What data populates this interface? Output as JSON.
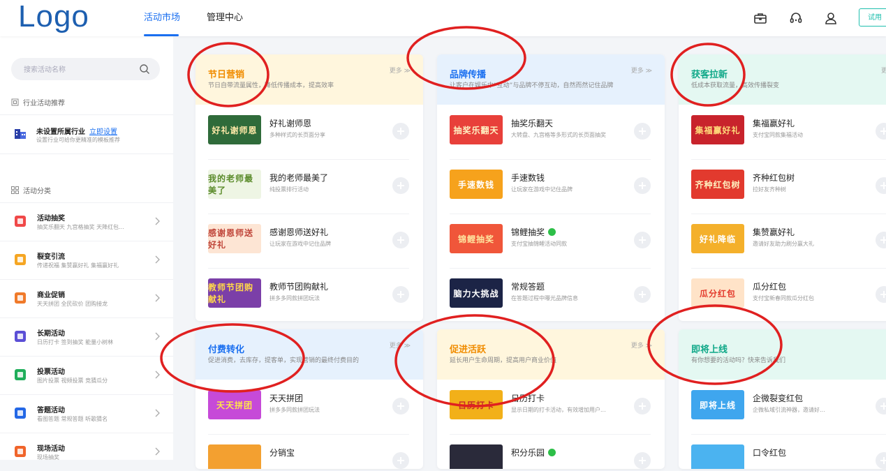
{
  "header": {
    "logo": "Logo",
    "tabs": [
      "活动市场",
      "管理中心"
    ],
    "active_tab": 0,
    "icons": [
      "briefcase-icon",
      "headset-icon",
      "user-icon"
    ],
    "trial_label": "试用"
  },
  "sidebar": {
    "search_placeholder": "搜索活动名称",
    "industry_section": "行业活动推荐",
    "industry": {
      "title": "未设置所属行业",
      "link": "立即设置",
      "subtitle": "设置行业可给你更精准的模板推荐"
    },
    "category_section": "活动分类",
    "categories": [
      {
        "title": "活动抽奖",
        "subtitle": "抽奖乐翻天  九宫格抽奖  天降红包...",
        "color": "#f04848"
      },
      {
        "title": "裂变引流",
        "subtitle": "传递祝福  集赞赢好礼  集福赢好礼",
        "color": "#f5a623"
      },
      {
        "title": "商业促销",
        "subtitle": "天天拼团  全民砍价  团购接龙",
        "color": "#f07a2a"
      },
      {
        "title": "长期活动",
        "subtitle": "日历打卡  签到抽奖  能量小树林",
        "color": "#5b4fd6"
      },
      {
        "title": "投票活动",
        "subtitle": "图片投票  视频投票  竞猜瓜分",
        "color": "#1fae5a"
      },
      {
        "title": "答题活动",
        "subtitle": "看图答题  常规答题  听歌猜名",
        "color": "#2468e6"
      },
      {
        "title": "现场活动",
        "subtitle": "现场抽奖",
        "color": "#f0642a"
      }
    ]
  },
  "cards": [
    {
      "title": "节日营销",
      "title_color": "#f08c00",
      "head_bg": "#fff6dd",
      "desc": "节日自带流量属性，降低传播成本，提高效率",
      "more": "更多 ≫",
      "items": [
        {
          "title": "好礼谢师恩",
          "subtitle": "多种样式的长页面分享",
          "thumb_text": "好礼谢师恩",
          "thumb_bg": "#2f6b3a",
          "thumb_fg": "#ffe9a8"
        },
        {
          "title": "我的老师最美了",
          "subtitle": "纯投票排行活动",
          "thumb_text": "我的老师最美了",
          "thumb_bg": "#eef5e4",
          "thumb_fg": "#5a8b2a"
        },
        {
          "title": "感谢恩师送好礼",
          "subtitle": "让玩家在游戏中记住品牌",
          "thumb_text": "感谢恩师送好礼",
          "thumb_bg": "#fde5d4",
          "thumb_fg": "#c0463a"
        },
        {
          "title": "教师节团购献礼",
          "subtitle": "拼多多同款拼团玩法",
          "thumb_text": "教师节团购献礼",
          "thumb_bg": "#7b3fa8",
          "thumb_fg": "#ffd84a"
        }
      ]
    },
    {
      "title": "品牌传播",
      "title_color": "#1a6ff0",
      "head_bg": "#e6f1fd",
      "desc": "让客户在娱乐中“互动”与品牌不停互动，自然而然记住品牌",
      "more": "更多 ≫",
      "items": [
        {
          "title": "抽奖乐翻天",
          "subtitle": "大转盘、九宫格等多形式的长页面抽奖",
          "thumb_text": "抽奖乐翻天",
          "thumb_bg": "#e8403a",
          "thumb_fg": "#fff3c4",
          "badge": false
        },
        {
          "title": "手速数钱",
          "subtitle": "让玩家在游戏中记住品牌",
          "thumb_text": "手速数钱",
          "thumb_bg": "#f6a21c",
          "thumb_fg": "#ffffff",
          "badge": false
        },
        {
          "title": "锦鲤抽奖",
          "subtitle": "支付宝抽锦鲤活动同款",
          "thumb_text": "锦鲤抽奖",
          "thumb_bg": "#f0563a",
          "thumb_fg": "#ffe6a0",
          "badge": true
        },
        {
          "title": "常规答题",
          "subtitle": "在答题过程中曝光品牌信息",
          "thumb_text": "脑力大挑战",
          "thumb_bg": "#1c2446",
          "thumb_fg": "#ffffff",
          "badge": false
        }
      ]
    },
    {
      "title": "获客拉新",
      "title_color": "#0fa888",
      "head_bg": "#e4f8f2",
      "desc": "低成本获取流量，高效传播裂变",
      "more": "更多",
      "items": [
        {
          "title": "集福赢好礼",
          "subtitle": "支付宝同款集福活动",
          "thumb_text": "集福赢好礼",
          "thumb_bg": "#c8232c",
          "thumb_fg": "#ffd97a"
        },
        {
          "title": "齐种红包树",
          "subtitle": "拉好友齐种树",
          "thumb_text": "齐种红包树",
          "thumb_bg": "#e23a2e",
          "thumb_fg": "#fff1c0"
        },
        {
          "title": "集赞赢好礼",
          "subtitle": "邀请好友助力刷分赢大礼",
          "thumb_text": "好礼降临",
          "thumb_bg": "#f4b02b",
          "thumb_fg": "#ffffff"
        },
        {
          "title": "瓜分红包",
          "subtitle": "支付宝新春同款瓜分红包",
          "thumb_text": "瓜分红包",
          "thumb_bg": "#ffe3c8",
          "thumb_fg": "#e33a2c"
        }
      ]
    },
    {
      "title": "付费转化",
      "title_color": "#1a6ff0",
      "head_bg": "#e6f1fd",
      "desc": "促进消费，去库存，提客单，实现营销的最终付费目的",
      "more": "更多 ≫",
      "items": [
        {
          "title": "天天拼团",
          "subtitle": "拼多多同款拼团玩法",
          "thumb_text": "天天拼团",
          "thumb_bg": "#c64ad8",
          "thumb_fg": "#ffe54a"
        },
        {
          "title": "分销宝",
          "subtitle": "",
          "thumb_text": "",
          "thumb_bg": "#f3a030",
          "thumb_fg": "#ffffff"
        }
      ]
    },
    {
      "title": "促进活跃",
      "title_color": "#f08c00",
      "head_bg": "#fff6dd",
      "desc": "延长用户生命周期，提高用户商业价值",
      "more": "更多 ≫",
      "items": [
        {
          "title": "日历打卡",
          "subtitle": "显示日期的打卡活动，有效增加用户...",
          "thumb_text": "日历打卡",
          "thumb_bg": "#f2b019",
          "thumb_fg": "#c62a2a",
          "badge": false
        },
        {
          "title": "积分乐园",
          "subtitle": "",
          "thumb_text": "",
          "thumb_bg": "#2a2a3a",
          "thumb_fg": "#ffffff",
          "badge": true
        }
      ]
    },
    {
      "title": "即将上线",
      "title_color": "#0fa888",
      "head_bg": "#e4f8f2",
      "desc": "有你想要的活动吗？快来告诉我们",
      "more": "",
      "items": [
        {
          "title": "企微裂变红包",
          "subtitle": "企微私域引流神器，邀请好...",
          "thumb_text": "即将上线",
          "thumb_bg": "#3fa6ee",
          "thumb_fg": "#ffffff"
        },
        {
          "title": "口令红包",
          "subtitle": "",
          "thumb_text": "",
          "thumb_bg": "#4bb3f0",
          "thumb_fg": "#ffffff"
        }
      ]
    }
  ]
}
